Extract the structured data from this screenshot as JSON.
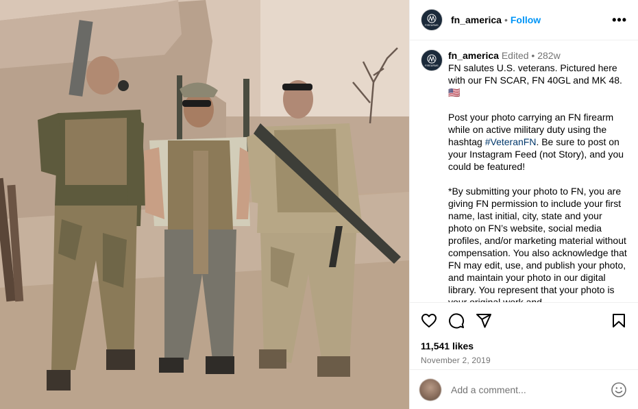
{
  "post": {
    "username": "fn_america",
    "follow_label": "Follow",
    "separator": "•",
    "more_label": "•••",
    "avatar_brand": "FIREARMS"
  },
  "caption": {
    "username": "fn_america",
    "edited": "Edited",
    "meta_dot": "•",
    "age": "282w",
    "line1": "FN salutes U.S. veterans. Pictured here with our FN SCAR, FN 40GL and MK 48.",
    "flag": "🇺🇸",
    "p2_before": "Post your photo carrying an FN firearm while on active military duty using the hashtag ",
    "hashtag": "#VeteranFN",
    "p2_after": ". Be sure to post on your Instagram Feed (not Story), and you could be featured!",
    "p3": "*By submitting your photo to FN, you are giving FN permission to include your first name, last initial, city, state and your photo on FN’s website, social media profiles, and/or marketing material without compensation. You also acknowledge that FN may edit, use, and publish your photo, and maintain your photo in our digital library. You represent that your photo is your original work and"
  },
  "engagement": {
    "likes": "11,541 likes",
    "date": "November 2, 2019"
  },
  "comment": {
    "placeholder": "Add a comment..."
  },
  "icons": {
    "avatar": "fn-logo-icon",
    "like": "heart-icon",
    "comment": "comment-bubble-icon",
    "share": "paper-plane-icon",
    "save": "bookmark-icon",
    "emoji": "smiley-icon",
    "more": "ellipsis-icon"
  },
  "colors": {
    "follow": "#0095f6",
    "hashtag": "#00376b",
    "secondary_text": "#737373"
  }
}
